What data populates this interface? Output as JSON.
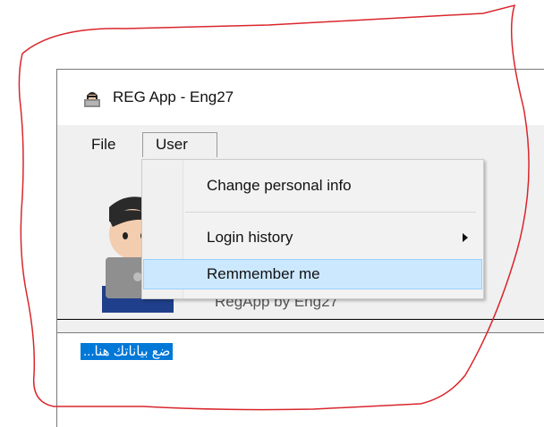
{
  "window": {
    "title": "REG App - Eng27"
  },
  "menubar": {
    "file_label": "File",
    "user_label": "User"
  },
  "user_menu": {
    "items": [
      {
        "label": "Change personal info"
      },
      {
        "label": "Login history",
        "has_submenu": true
      },
      {
        "label": "Remmember me",
        "highlighted": true
      }
    ]
  },
  "content": {
    "footer_text": "RegApp by Eng27"
  },
  "input": {
    "selected_text": "ضع بياناتك هنا..."
  },
  "colors": {
    "selection": "#0078d7",
    "menu_highlight": "#cce8ff",
    "annotation_outline": "#d9262c"
  },
  "icons": {
    "app_icon": "hacker-laptop-icon",
    "avatar": "person-with-laptop-avatar",
    "submenu": "chevron-right-icon"
  }
}
